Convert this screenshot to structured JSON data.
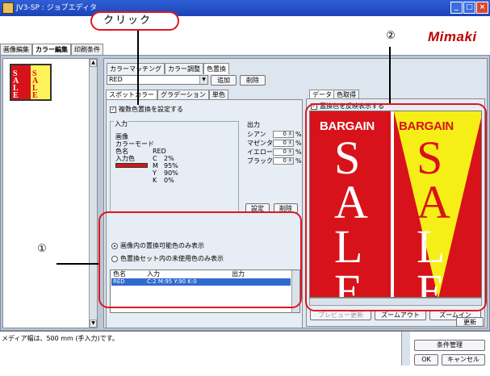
{
  "window": {
    "title": "JV3-SP : ジョブエディタ",
    "logo": "Mimaki"
  },
  "main_tabs": [
    "画像編集",
    "カラー編集",
    "印刷条件"
  ],
  "color_tabs": [
    "カラーマッチング",
    "カラー調整",
    "色置換"
  ],
  "color_select": {
    "value": "RED"
  },
  "buttons": {
    "add": "追加",
    "delete": "削除",
    "set": "設定",
    "remove": "削除",
    "preview_update": "プレビュー更新",
    "zoom_out": "ズームアウト",
    "zoom_in": "ズームイン",
    "refresh": "更新",
    "condition_mgmt": "条件管理",
    "ok": "OK",
    "cancel": "キャンセル"
  },
  "sub_tabs": [
    "スポットカラー",
    "グラデーション",
    "単色"
  ],
  "multi_replace_label": "複数色置換を設定する",
  "input_section": {
    "legend": "入力",
    "image_label": "画像",
    "color_mode_label": "カラーモード",
    "color_name_label": "色名",
    "color_name_value": "RED",
    "input_color_label": "入力色",
    "cmyk": [
      {
        "ch": "C",
        "value": "2%"
      },
      {
        "ch": "M",
        "value": "95%"
      },
      {
        "ch": "Y",
        "value": "90%"
      },
      {
        "ch": "K",
        "value": "0%"
      }
    ]
  },
  "output_section": {
    "legend": "出力",
    "rows": [
      {
        "label": "シアン",
        "value": "0",
        "unit": "%"
      },
      {
        "label": "マゼンタ",
        "value": "0",
        "unit": "%"
      },
      {
        "label": "イエロー",
        "value": "0",
        "unit": "%"
      },
      {
        "label": "ブラック",
        "value": "0",
        "unit": "%"
      }
    ]
  },
  "radio_options": {
    "opt1": "画像内の置換可能色のみ表示",
    "opt2": "色置換セット内の未使用色のみ表示"
  },
  "table": {
    "headers": [
      "色名",
      "入力",
      "出力"
    ],
    "rows": [
      {
        "name": "RED",
        "input": "C:2 M:95 Y:90 K:0",
        "output": ""
      }
    ]
  },
  "right_tabs": [
    "データ",
    "色取得"
  ],
  "preview_checkbox": "置換色を反映表示する",
  "preview": {
    "bargain": "BARGAIN",
    "sale_letters": [
      "S",
      "A",
      "L",
      "E"
    ]
  },
  "status": {
    "message": "メディア幅は、500 mm (手入力)です。"
  },
  "annotations": {
    "click_label": "クリック",
    "marker1": "①",
    "marker2": "②"
  },
  "colors": {
    "accent_red": "#e0161f",
    "sale_red": "#d8121a",
    "pennant_yellow": "#f6ef17",
    "selection_blue": "#2f6ad0"
  }
}
